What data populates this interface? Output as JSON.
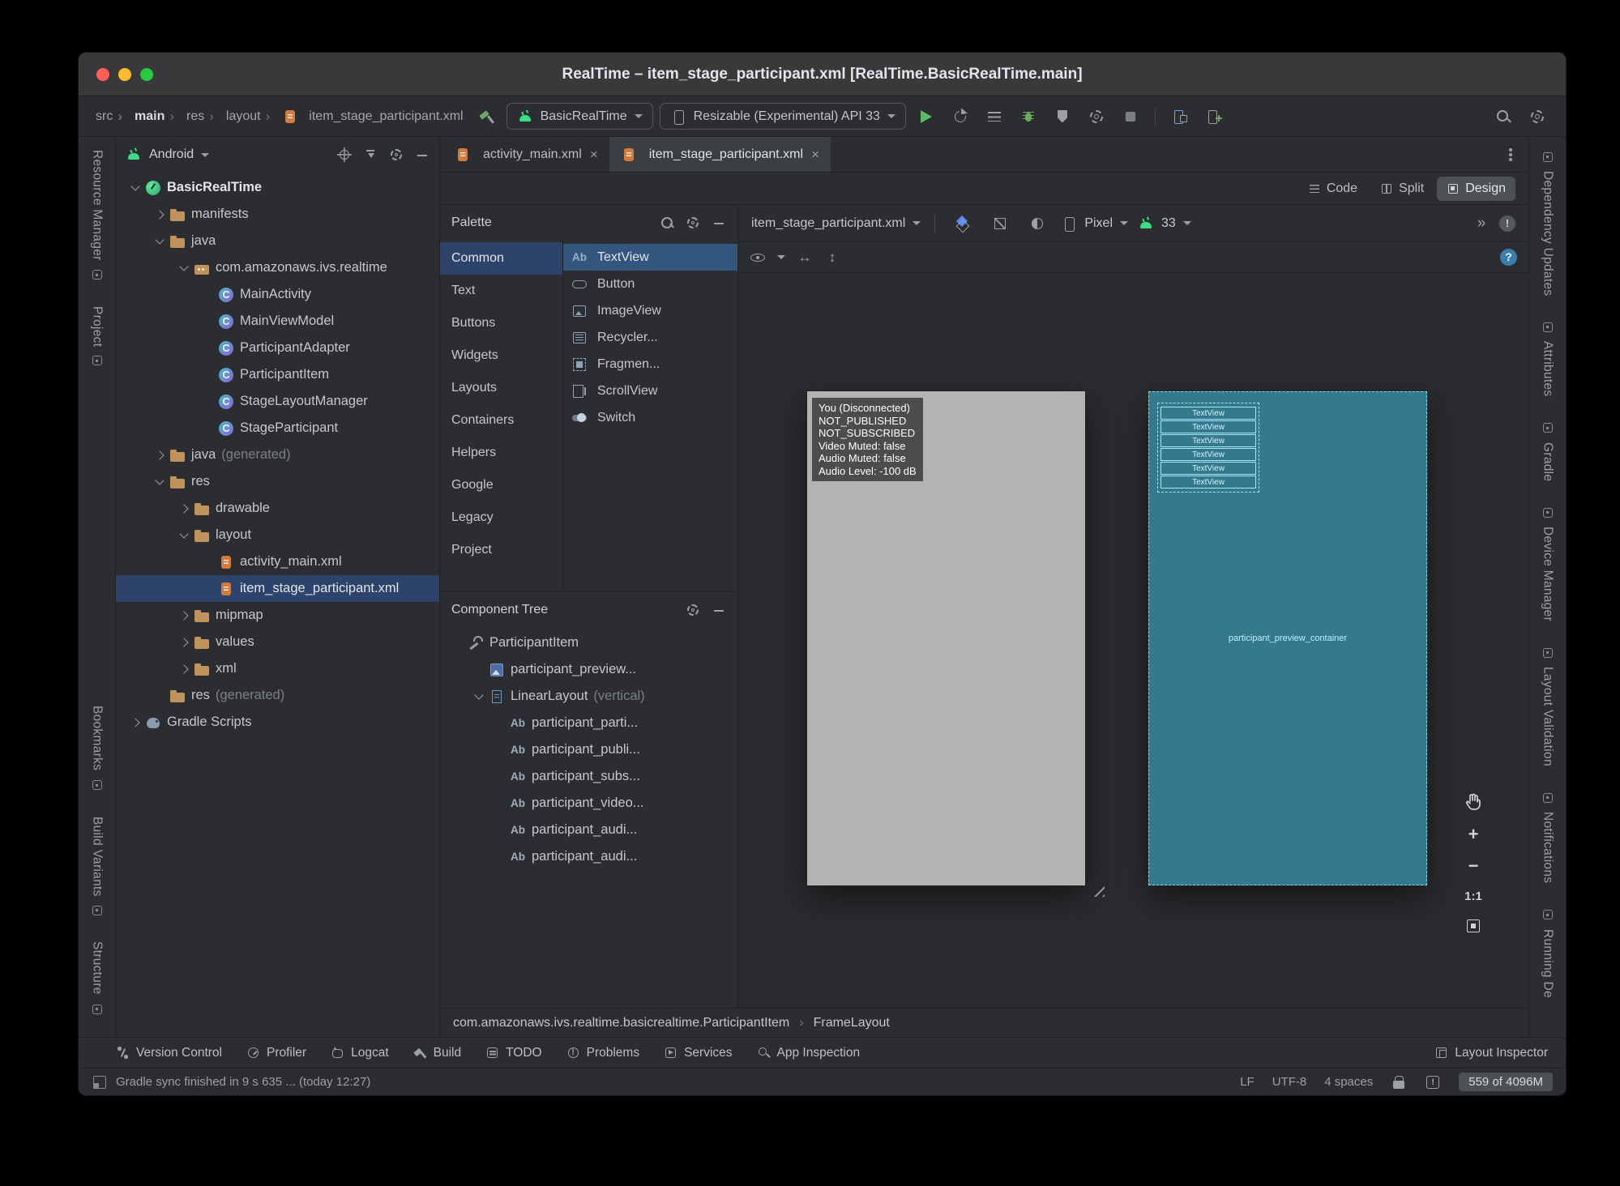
{
  "window_title": "RealTime – item_stage_participant.xml [RealTime.BasicRealTime.main]",
  "toolbar": {
    "breadcrumb": [
      {
        "label": "src"
      },
      {
        "label": "main",
        "bold": true
      },
      {
        "label": "res"
      },
      {
        "label": "layout"
      },
      {
        "label": "item_stage_participant.xml",
        "icon": "xmlfile"
      }
    ],
    "run_config_label": "BasicRealTime",
    "device_label": "Resizable (Experimental) API 33"
  },
  "left_strip": [
    {
      "label": "Resource Manager"
    },
    {
      "label": "Project"
    },
    {
      "label": "Bookmarks"
    },
    {
      "label": "Build Variants"
    },
    {
      "label": "Structure"
    }
  ],
  "right_strip": [
    {
      "label": "Dependency Updates"
    },
    {
      "label": "Attributes"
    },
    {
      "label": "Gradle"
    },
    {
      "label": "Device Manager"
    },
    {
      "label": "Layout Validation"
    },
    {
      "label": "Notifications"
    },
    {
      "label": "Running De"
    }
  ],
  "project_panel": {
    "selector": "Android",
    "tree": [
      {
        "label": "BasicRealTime",
        "icon": "project",
        "level": 0,
        "chevron": "down",
        "bold": true
      },
      {
        "label": "manifests",
        "icon": "folder",
        "level": 1,
        "chevron": "right"
      },
      {
        "label": "java",
        "icon": "folder",
        "level": 1,
        "chevron": "down"
      },
      {
        "label": "com.amazonaws.ivs.realtime",
        "icon": "package",
        "level": 2,
        "chevron": "down"
      },
      {
        "label": "MainActivity",
        "icon": "kclass",
        "level": 3,
        "chevron": "none"
      },
      {
        "label": "MainViewModel",
        "icon": "kclass",
        "level": 3,
        "chevron": "none"
      },
      {
        "label": "ParticipantAdapter",
        "icon": "kclass",
        "level": 3,
        "chevron": "none"
      },
      {
        "label": "ParticipantItem",
        "icon": "kclass",
        "level": 3,
        "chevron": "none"
      },
      {
        "label": "StageLayoutManager",
        "icon": "kclass",
        "level": 3,
        "chevron": "none"
      },
      {
        "label": "StageParticipant",
        "icon": "kclass",
        "level": 3,
        "chevron": "none"
      },
      {
        "label": "java",
        "suffix": "(generated)",
        "icon": "folder",
        "level": 1,
        "chevron": "right"
      },
      {
        "label": "res",
        "icon": "folder",
        "level": 1,
        "chevron": "down"
      },
      {
        "label": "drawable",
        "icon": "folder",
        "level": 2,
        "chevron": "right"
      },
      {
        "label": "layout",
        "icon": "folder",
        "level": 2,
        "chevron": "down"
      },
      {
        "label": "activity_main.xml",
        "icon": "xmlfile",
        "level": 3,
        "chevron": "none"
      },
      {
        "label": "item_stage_participant.xml",
        "icon": "xmlfile",
        "level": 3,
        "chevron": "none",
        "selected": true
      },
      {
        "label": "mipmap",
        "icon": "folder",
        "level": 2,
        "chevron": "right"
      },
      {
        "label": "values",
        "icon": "folder",
        "level": 2,
        "chevron": "right"
      },
      {
        "label": "xml",
        "icon": "folder",
        "level": 2,
        "chevron": "right"
      },
      {
        "label": "res",
        "suffix": "(generated)",
        "icon": "folder",
        "level": 1,
        "chevron": "none"
      },
      {
        "label": "Gradle Scripts",
        "icon": "gradle",
        "level": 0,
        "chevron": "right"
      }
    ]
  },
  "tabs": [
    {
      "label": "activity_main.xml",
      "icon": "xmlfile"
    },
    {
      "label": "item_stage_participant.xml",
      "icon": "xmlfile",
      "active": true
    }
  ],
  "modes": [
    {
      "label": "Code",
      "icon": "code-view"
    },
    {
      "label": "Split",
      "icon": "split-view"
    },
    {
      "label": "Design",
      "icon": "design-view",
      "active": true
    }
  ],
  "palette": {
    "title": "Palette",
    "categories": [
      {
        "label": "Common",
        "selected": true
      },
      {
        "label": "Text"
      },
      {
        "label": "Buttons"
      },
      {
        "label": "Widgets"
      },
      {
        "label": "Layouts"
      },
      {
        "label": "Containers"
      },
      {
        "label": "Helpers"
      },
      {
        "label": "Google"
      },
      {
        "label": "Legacy"
      },
      {
        "label": "Project"
      }
    ],
    "components": [
      {
        "label": "TextView",
        "icon": "ab",
        "selected": true
      },
      {
        "label": "Button",
        "icon": "button"
      },
      {
        "label": "ImageView",
        "icon": "imageview"
      },
      {
        "label": "Recycler...",
        "icon": "recycler"
      },
      {
        "label": "Fragmen...",
        "icon": "fragment"
      },
      {
        "label": "ScrollView",
        "icon": "scrollview"
      },
      {
        "label": "Switch",
        "icon": "switch"
      }
    ]
  },
  "component_tree": {
    "title": "Component Tree",
    "items": [
      {
        "label": "ParticipantItem",
        "icon": "wrench",
        "level": 0,
        "chevron": "none"
      },
      {
        "label": "participant_preview...",
        "icon": "view",
        "level": 1,
        "chevron": "none"
      },
      {
        "label": "LinearLayout",
        "suffix": "(vertical)",
        "icon": "linear",
        "level": 1,
        "chevron": "down"
      },
      {
        "label": "participant_parti...",
        "icon": "ab",
        "level": 2,
        "chevron": "none"
      },
      {
        "label": "participant_publi...",
        "icon": "ab",
        "level": 2,
        "chevron": "none"
      },
      {
        "label": "participant_subs...",
        "icon": "ab",
        "level": 2,
        "chevron": "none"
      },
      {
        "label": "participant_video...",
        "icon": "ab",
        "level": 2,
        "chevron": "none"
      },
      {
        "label": "participant_audi...",
        "icon": "ab",
        "level": 2,
        "chevron": "none"
      },
      {
        "label": "participant_audi...",
        "icon": "ab",
        "level": 2,
        "chevron": "none"
      }
    ]
  },
  "design": {
    "file_selector": "item_stage_participant.xml",
    "device_selector": "Pixel",
    "api_selector": "33",
    "preview_lines": [
      "You (Disconnected)",
      "NOT_PUBLISHED",
      "NOT_SUBSCRIBED",
      "Video Muted: false",
      "Audio Muted: false",
      "Audio Level: -100 dB"
    ],
    "blueprint_textviews": [
      "TextView",
      "TextView",
      "TextView",
      "TextView",
      "TextView",
      "TextView"
    ],
    "blueprint_container_label": "participant_preview_container",
    "zoom_level_label": "1:1"
  },
  "editor_breadcrumb": [
    "com.amazonaws.ivs.realtime.basicrealtime.ParticipantItem",
    "FrameLayout"
  ],
  "bottom_bar": {
    "items": [
      {
        "label": "Version Control",
        "icon": "version-control"
      },
      {
        "label": "Profiler",
        "icon": "profiler"
      },
      {
        "label": "Logcat",
        "icon": "logcat"
      },
      {
        "label": "Build",
        "icon": "build"
      },
      {
        "label": "TODO",
        "icon": "todo"
      },
      {
        "label": "Problems",
        "icon": "problems"
      },
      {
        "label": "Services",
        "icon": "services"
      },
      {
        "label": "App Inspection",
        "icon": "app-inspection"
      }
    ],
    "right_label": "Layout Inspector"
  },
  "status_bar": {
    "message": "Gradle sync finished in 9 s 635 ... (today 12:27)",
    "line_separator": "LF",
    "encoding": "UTF-8",
    "indent": "4 spaces",
    "memory": "559 of 4096M"
  },
  "colors": {
    "android_green": "#3ddc84",
    "run_green": "#5fb865",
    "selection_blue": "#2d436b",
    "blueprint_teal": "#35798f",
    "blueprint_line": "#a5e6f7"
  }
}
